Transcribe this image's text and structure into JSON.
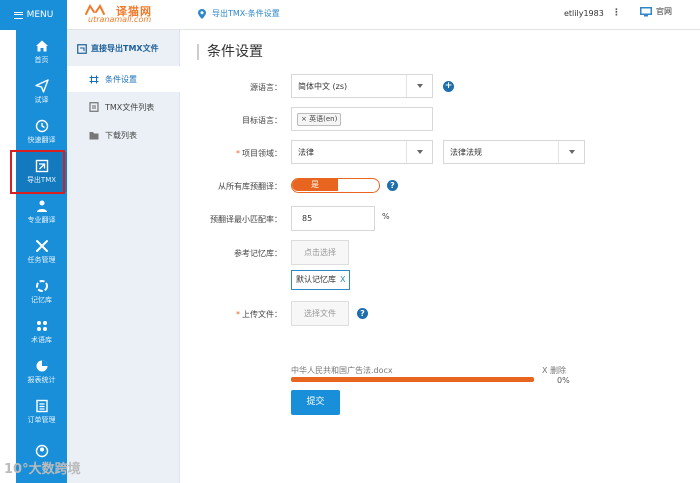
{
  "topbar": {
    "menu_label": "MENU",
    "logo_name": "译猫网",
    "logo_domain": "utranamall.com",
    "breadcrumb": "导出TMX-条件设置",
    "username": "etlily1983",
    "more": "⋮",
    "site_label": "官网"
  },
  "leftnav": {
    "items": [
      {
        "label": "首页",
        "icon": "home-icon"
      },
      {
        "label": "试译",
        "icon": "send-icon"
      },
      {
        "label": "快速翻译",
        "icon": "clock-icon"
      },
      {
        "label": "导出TMX",
        "icon": "export-icon"
      },
      {
        "label": "专业翻译",
        "icon": "users-icon"
      },
      {
        "label": "任务管理",
        "icon": "tools-icon"
      },
      {
        "label": "记忆库",
        "icon": "ring-icon"
      },
      {
        "label": "术语库",
        "icon": "dots-icon"
      },
      {
        "label": "报表统计",
        "icon": "pie-icon"
      },
      {
        "label": "订单管理",
        "icon": "list-icon"
      },
      {
        "label": "",
        "icon": "account-icon"
      }
    ]
  },
  "subnav": {
    "title": "直接导出TMX文件",
    "items": [
      {
        "label": "条件设置"
      },
      {
        "label": "TMX文件列表"
      },
      {
        "label": "下载列表"
      }
    ]
  },
  "main": {
    "title": "条件设置",
    "source_lang_label": "源语言：",
    "source_lang_value": "简体中文 (zs)",
    "target_lang_label": "目标语言：",
    "target_tag": "× 英语(en)",
    "domain_label": "项目领域：",
    "domain_value": "法律",
    "subdomain_value": "法律法规",
    "pretranslate_label": "从所有库预翻译：",
    "toggle_on": "是",
    "min_match_label": "预翻译最小匹配率：",
    "min_match_value": "85",
    "percent": "%",
    "memory_label": "参考记忆库：",
    "memory_btn": "点击选择",
    "memory_tag": "默认记忆库",
    "memory_tag_close": "X",
    "upload_label": "上传文件：",
    "upload_btn": "选择文件",
    "file_name": "中华人民共和国广告法.docx",
    "file_delete": "X 删除",
    "progress_text": "0%",
    "submit": "提交",
    "help": "?"
  },
  "watermark": "10°大数跨境",
  "colors": {
    "brand_blue": "#1a8fd9",
    "accent_orange": "#e8651f",
    "highlight_red": "#d81e1e",
    "arrow_yellow": "#f6b81c"
  }
}
